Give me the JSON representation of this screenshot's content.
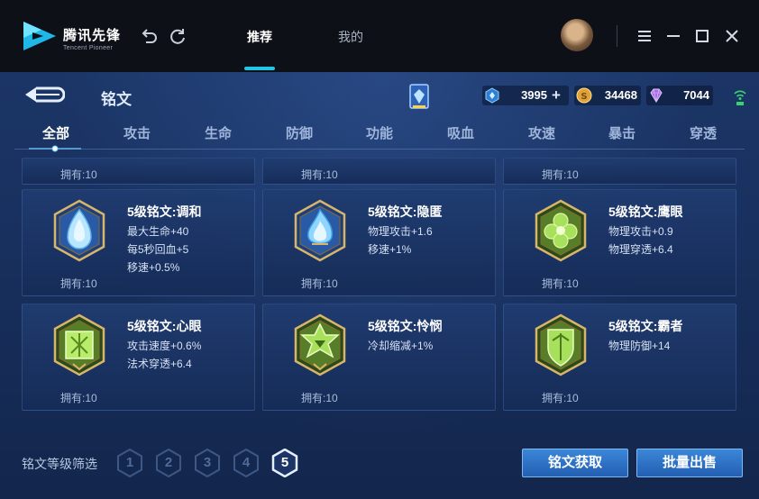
{
  "app": {
    "logo_cn": "腾讯先锋",
    "logo_en": "Tencent Pioneer",
    "tabs": [
      {
        "label": "推荐",
        "active": true
      },
      {
        "label": "我的",
        "active": false
      }
    ],
    "accent": "#1fc7e6"
  },
  "game": {
    "title": "铭文",
    "currencies": [
      {
        "icon": "hex-crystal-icon",
        "value": "3995",
        "has_plus": true
      },
      {
        "icon": "gold-coin-icon",
        "value": "34468"
      },
      {
        "icon": "purple-gem-icon",
        "value": "7044"
      }
    ],
    "categories": [
      {
        "label": "全部",
        "active": true
      },
      {
        "label": "攻击"
      },
      {
        "label": "生命"
      },
      {
        "label": "防御"
      },
      {
        "label": "功能"
      },
      {
        "label": "吸血"
      },
      {
        "label": "攻速"
      },
      {
        "label": "暴击"
      },
      {
        "label": "穿透"
      }
    ],
    "partial_row": [
      {
        "owned": "拥有:10"
      },
      {
        "owned": "拥有:10"
      },
      {
        "owned": "拥有:10"
      }
    ],
    "runes": [
      {
        "title": "5级铭文:调和",
        "attrs": [
          "最大生命+40",
          "每5秒回血+5",
          "移速+0.5%"
        ],
        "owned": "拥有:10",
        "style": "blue-teardrop"
      },
      {
        "title": "5级铭文:隐匿",
        "attrs": [
          "物理攻击+1.6",
          "移速+1%"
        ],
        "owned": "拥有:10",
        "style": "blue-flame"
      },
      {
        "title": "5级铭文:鹰眼",
        "attrs": [
          "物理攻击+0.9",
          "物理穿透+6.4"
        ],
        "owned": "拥有:10",
        "style": "green-clover"
      },
      {
        "title": "5级铭文:心眼",
        "attrs": [
          "攻击速度+0.6%",
          "法术穿透+6.4"
        ],
        "owned": "拥有:10",
        "style": "green-square"
      },
      {
        "title": "5级铭文:怜悯",
        "attrs": [
          "冷却缩减+1%"
        ],
        "owned": "拥有:10",
        "style": "green-star"
      },
      {
        "title": "5级铭文:霸者",
        "attrs": [
          "物理防御+14"
        ],
        "owned": "拥有:10",
        "style": "green-shield"
      }
    ],
    "filter_label": "铭文等级筛选",
    "levels": [
      {
        "n": "1",
        "active": false
      },
      {
        "n": "2",
        "active": false
      },
      {
        "n": "3",
        "active": false
      },
      {
        "n": "4",
        "active": false
      },
      {
        "n": "5",
        "active": true
      }
    ],
    "buttons": {
      "get": "铭文获取",
      "sell": "批量出售"
    }
  }
}
